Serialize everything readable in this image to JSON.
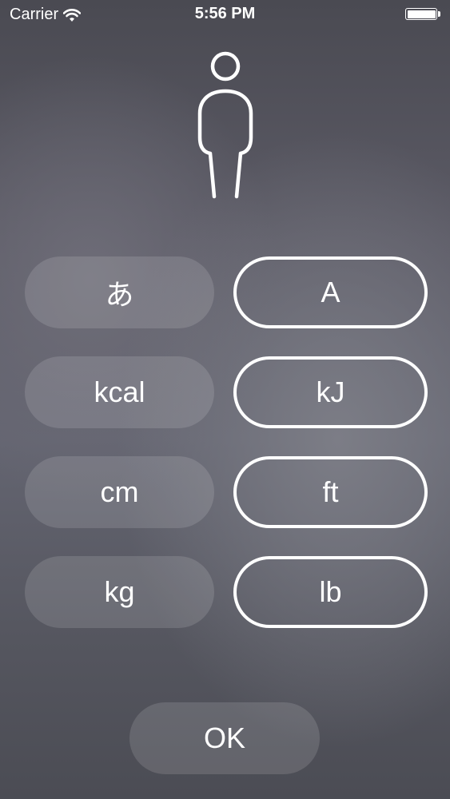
{
  "status_bar": {
    "carrier": "Carrier",
    "time": "5:56 PM"
  },
  "options": {
    "language_japanese": "あ",
    "language_english": "A",
    "energy_kcal": "kcal",
    "energy_kj": "kJ",
    "height_cm": "cm",
    "height_ft": "ft",
    "weight_kg": "kg",
    "weight_lb": "lb"
  },
  "ok_label": "OK",
  "colors": {
    "text": "#ffffff",
    "button_fill": "rgba(255,255,255,0.13)",
    "selected_outline": "#ffffff"
  },
  "icons": {
    "header": "person-icon",
    "wifi": "wifi-icon",
    "battery": "battery-icon"
  }
}
